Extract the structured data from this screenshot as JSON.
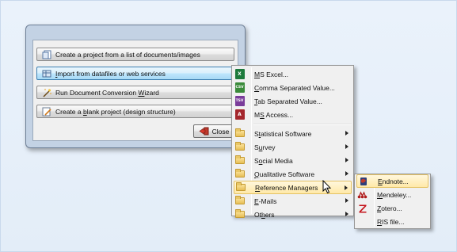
{
  "dialog": {
    "buttons": [
      {
        "label_pre": "Create a project from a list of documents/images",
        "hot": "",
        "label_post": ""
      },
      {
        "label_pre": "",
        "hot": "I",
        "label_post": "mport from datafiles or web services"
      },
      {
        "label_pre": "Run Document Conversion ",
        "hot": "W",
        "label_post": "izard"
      },
      {
        "label_pre": "Create a ",
        "hot": "b",
        "label_post": "lank project (design structure)"
      }
    ],
    "close_label": "Close"
  },
  "menu_import": {
    "items": [
      {
        "pre": "",
        "hot": "M",
        "post": "S Excel...",
        "icon": "excel-icon",
        "color": "#1d7a3c",
        "glyph": "X"
      },
      {
        "pre": "",
        "hot": "C",
        "post": "omma Separated Value...",
        "icon": "csv-icon",
        "color": "#3a8a3a",
        "glyph": "CSV"
      },
      {
        "pre": "",
        "hot": "T",
        "post": "ab Separated Value...",
        "icon": "tsv-icon",
        "color": "#7a3c9a",
        "glyph": "TSV"
      },
      {
        "pre": "M",
        "hot": "S",
        "post": " Access...",
        "icon": "access-icon",
        "color": "#a4262c",
        "glyph": "A"
      }
    ],
    "submenus": [
      {
        "pre": "S",
        "hot": "t",
        "post": "atistical Software"
      },
      {
        "pre": "S",
        "hot": "u",
        "post": "rvey"
      },
      {
        "pre": "S",
        "hot": "o",
        "post": "cial Media"
      },
      {
        "pre": "",
        "hot": "Q",
        "post": "ualitative Software"
      },
      {
        "pre": "",
        "hot": "R",
        "post": "eference Managers"
      },
      {
        "pre": "",
        "hot": "E",
        "post": "-Mails"
      },
      {
        "pre": "Ot",
        "hot": "h",
        "post": "ers"
      }
    ]
  },
  "menu_refmgr": {
    "items": [
      {
        "pre": "",
        "hot": "E",
        "post": "ndnote...",
        "icon": "endnote-icon"
      },
      {
        "pre": "",
        "hot": "M",
        "post": "endeley...",
        "icon": "mendeley-icon"
      },
      {
        "pre": "",
        "hot": "Z",
        "post": "otero...",
        "icon": "zotero-icon"
      },
      {
        "pre": "",
        "hot": "R",
        "post": "IS file...",
        "icon": "blank-icon"
      }
    ]
  },
  "colors": {
    "background": "#e4eef9",
    "highlight": "#ffe9a8",
    "active_button": "#bee6fd"
  }
}
